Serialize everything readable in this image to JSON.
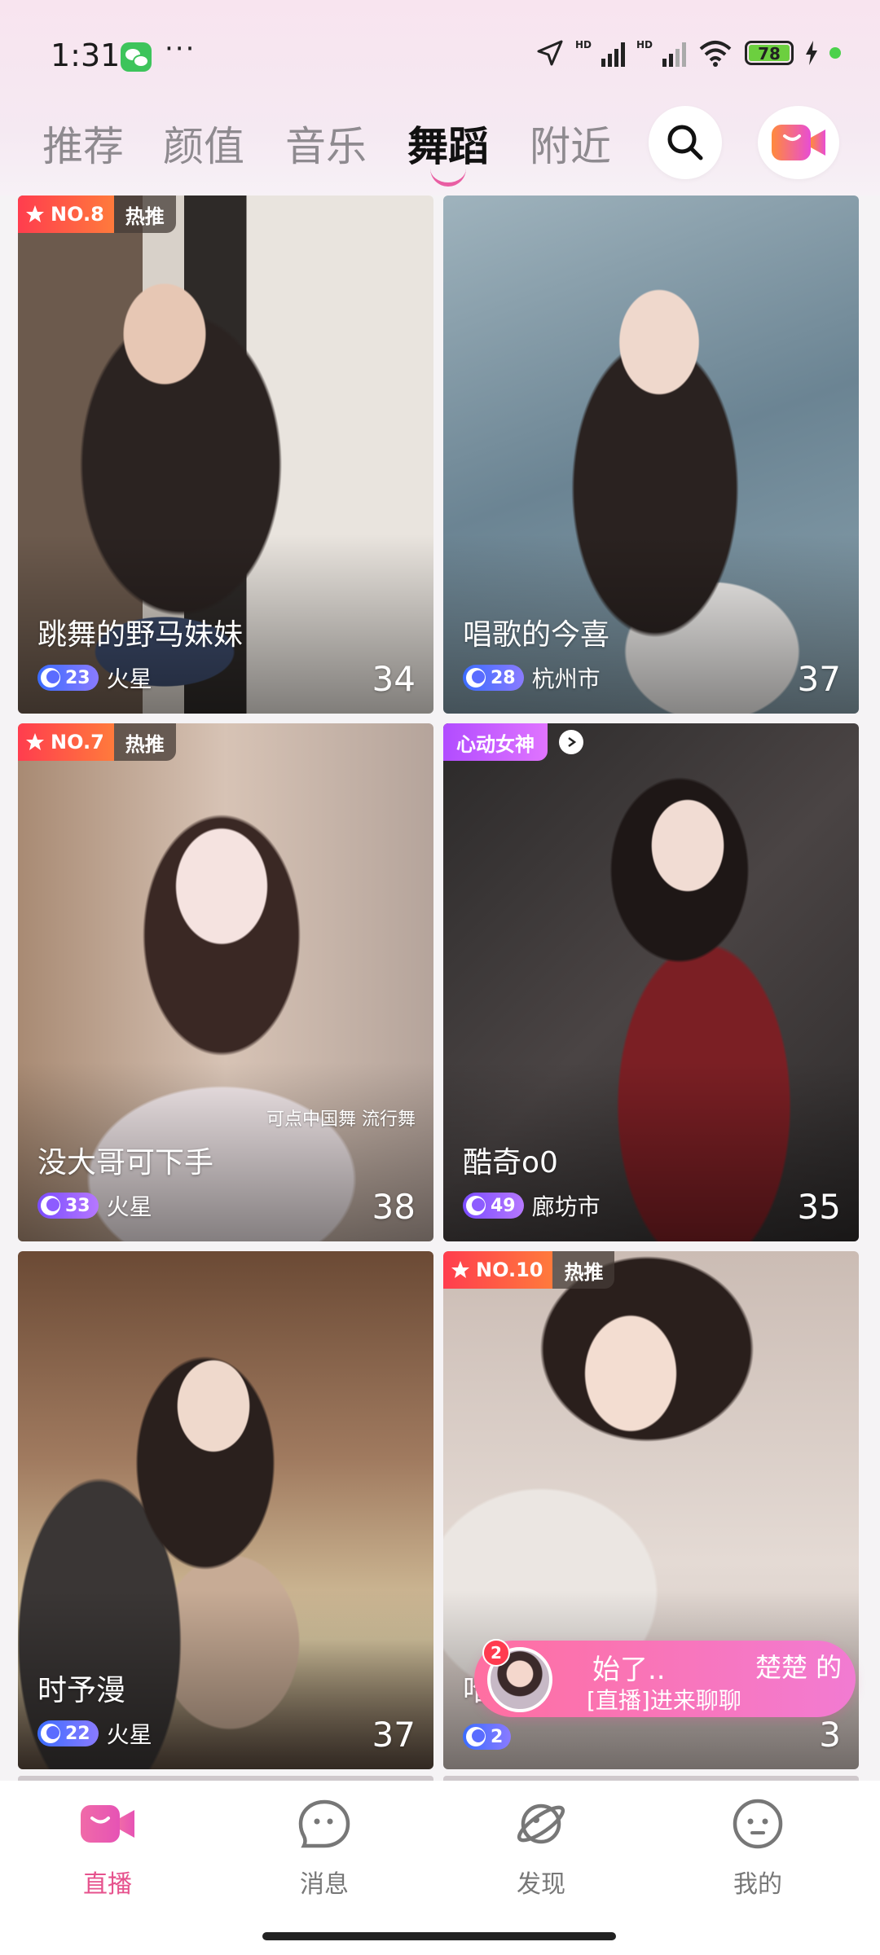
{
  "status_bar": {
    "time": "1:31",
    "dots": "···",
    "hd1": "HD",
    "hd2": "HD",
    "battery": "78"
  },
  "tabs": [
    {
      "label": "推荐",
      "active": false
    },
    {
      "label": "颜值",
      "active": false
    },
    {
      "label": "音乐",
      "active": false
    },
    {
      "label": "舞蹈",
      "active": true
    },
    {
      "label": "附近",
      "active": false
    }
  ],
  "cards": [
    {
      "rank": "NO.8",
      "hot": "热推",
      "name": "跳舞的野马妹妹",
      "level": "23",
      "location": "火星",
      "count": "34"
    },
    {
      "name": "唱歌的今喜",
      "level": "28",
      "location": "杭州市",
      "count": "37"
    },
    {
      "rank": "NO.7",
      "hot": "热推",
      "name": "没大哥可下手",
      "caption": "可点中国舞 流行舞",
      "level": "33",
      "location": "火星",
      "count": "38"
    },
    {
      "tag": "心动女神",
      "name": "酷奇o0",
      "level": "49",
      "location": "廊坊市",
      "count": "35"
    },
    {
      "name": "时予漫",
      "level": "22",
      "location": "火星",
      "count": "37"
    },
    {
      "rank": "NO.10",
      "hot": "热推",
      "name": "哈",
      "level": "2",
      "location": "",
      "count": "3"
    }
  ],
  "notification": {
    "count": "2",
    "title": "始了..",
    "name": "楚楚 的",
    "subtitle": "[直播]进来聊聊"
  },
  "bottom_nav": [
    {
      "label": "直播",
      "icon": "live-camera-icon",
      "active": true
    },
    {
      "label": "消息",
      "icon": "message-bubble-icon",
      "active": false
    },
    {
      "label": "发现",
      "icon": "planet-icon",
      "active": false
    },
    {
      "label": "我的",
      "icon": "profile-face-icon",
      "active": false
    }
  ],
  "colors": {
    "accent": "#e6528d",
    "rank_badge": "#ff3d4e",
    "level_badge": "#3b6cff"
  }
}
